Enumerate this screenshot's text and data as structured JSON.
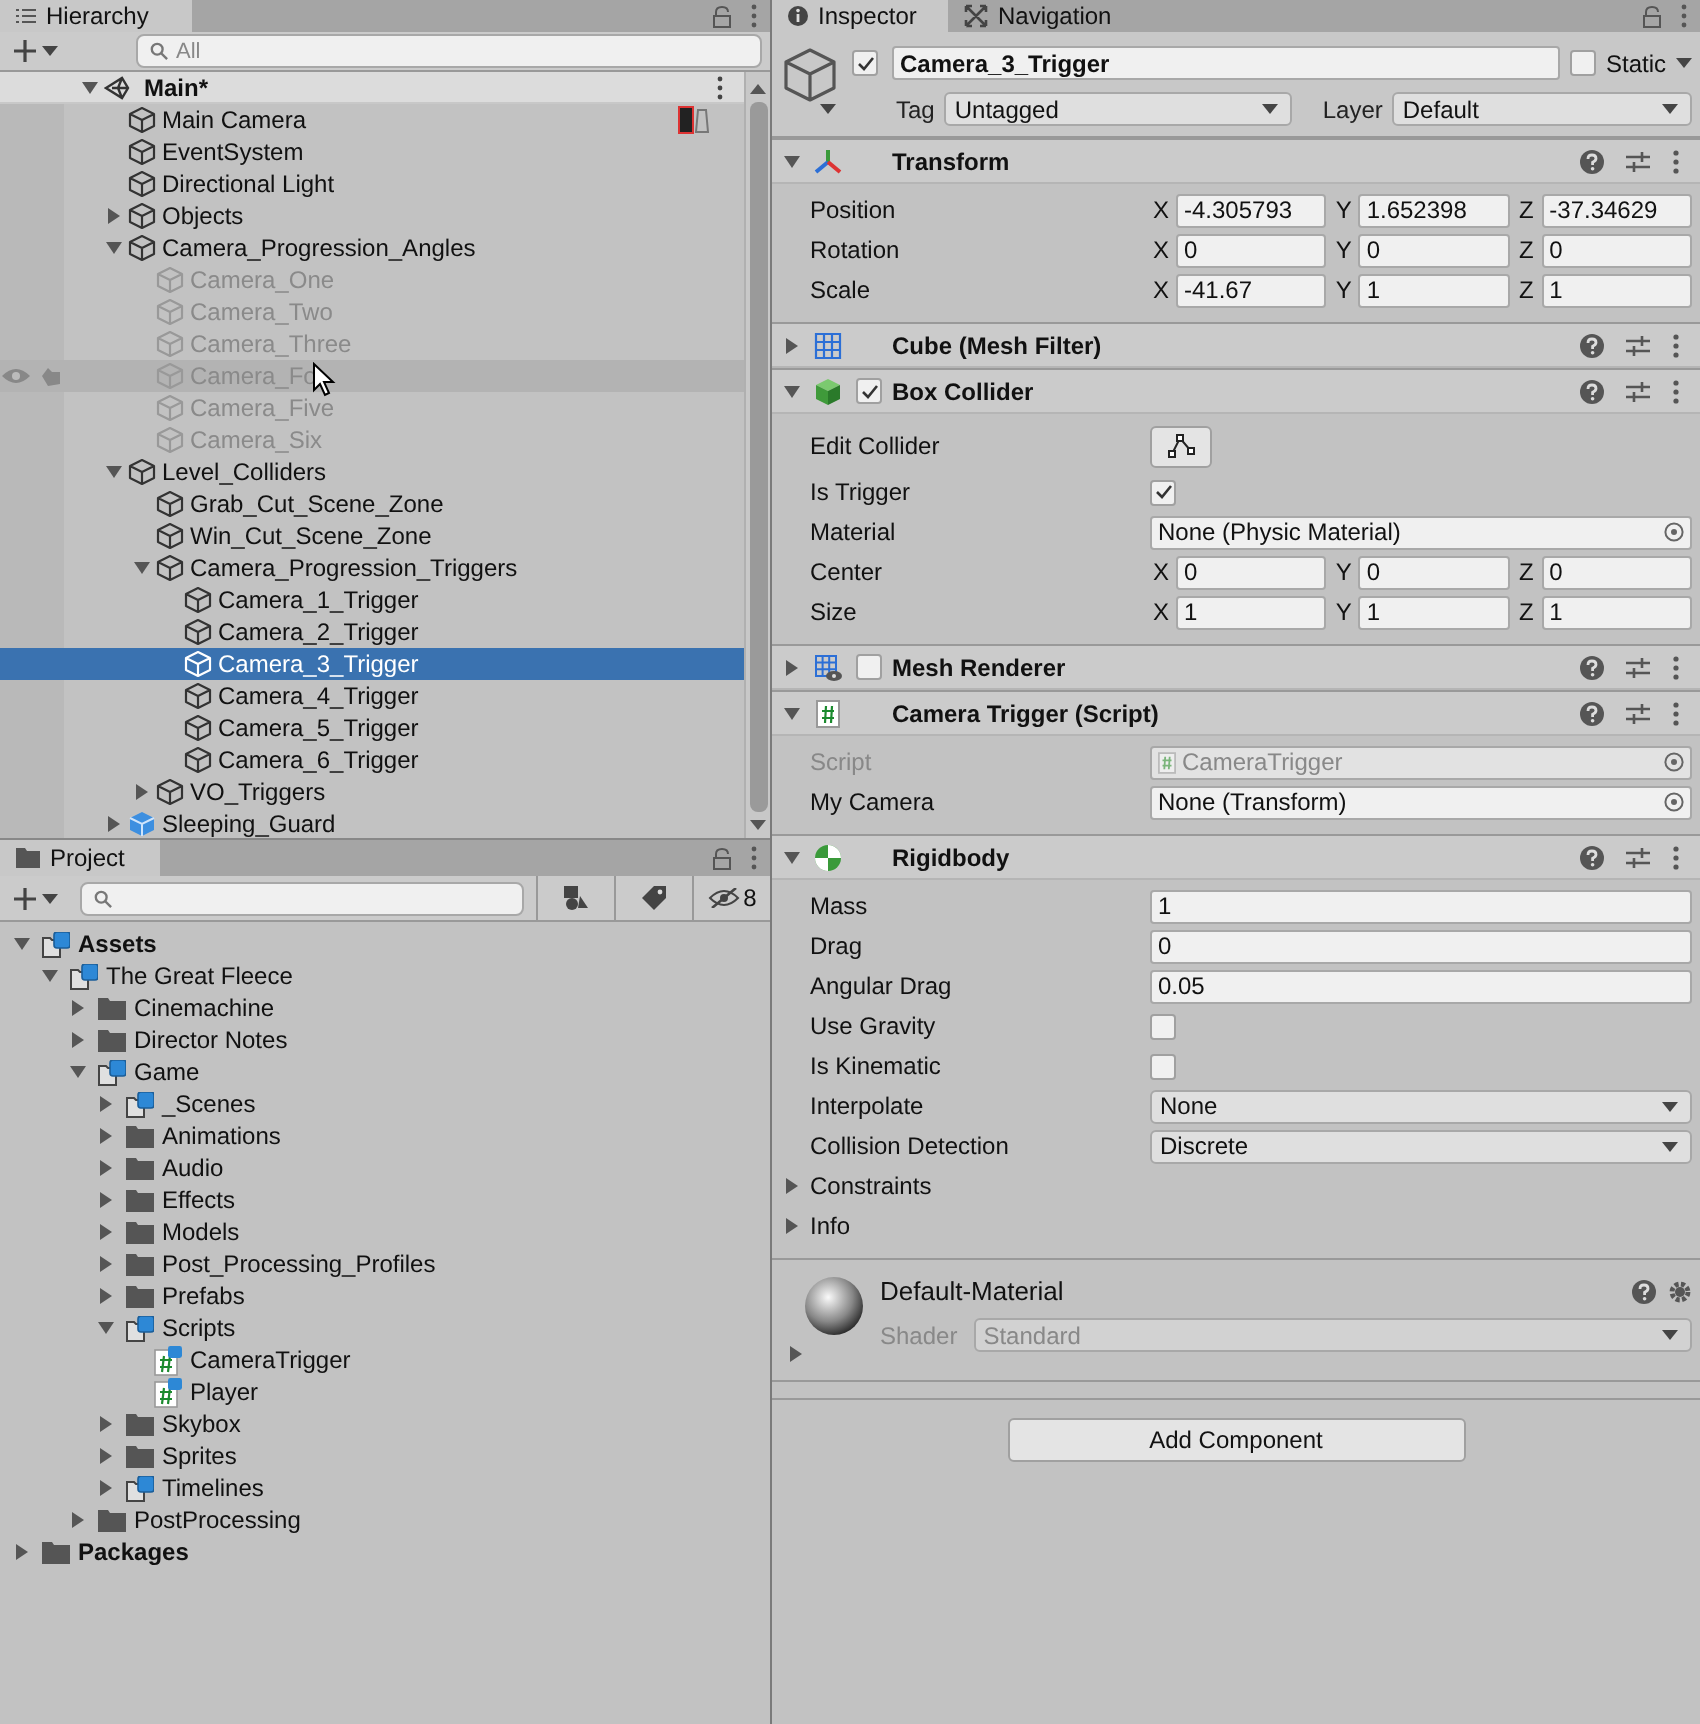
{
  "hierarchy": {
    "tab": "Hierarchy",
    "search_placeholder": "All",
    "scene": {
      "name": "Main*",
      "expanded": true
    },
    "items": [
      {
        "name": "Main Camera",
        "kind": "object",
        "active": true,
        "selected": false,
        "gizmo": true
      },
      {
        "name": "EventSystem",
        "kind": "object",
        "active": true,
        "selected": false
      },
      {
        "name": "Directional Light",
        "kind": "object",
        "active": true,
        "selected": false
      },
      {
        "name": "Objects",
        "kind": "object",
        "active": true,
        "selected": false,
        "expanded": false
      },
      {
        "name": "Camera_Progression_Angles",
        "kind": "object",
        "active": true,
        "selected": false,
        "expanded": true,
        "children": [
          {
            "name": "Camera_One",
            "kind": "object",
            "active": false,
            "selected": false
          },
          {
            "name": "Camera_Two",
            "kind": "object",
            "active": false,
            "selected": false
          },
          {
            "name": "Camera_Three",
            "kind": "object",
            "active": false,
            "selected": false
          },
          {
            "name": "Camera_Fo",
            "kind": "object",
            "active": false,
            "selected": false,
            "hovered": true
          },
          {
            "name": "Camera_Five",
            "kind": "object",
            "active": false,
            "selected": false
          },
          {
            "name": "Camera_Six",
            "kind": "object",
            "active": false,
            "selected": false
          }
        ]
      },
      {
        "name": "Level_Colliders",
        "kind": "object",
        "active": true,
        "selected": false,
        "expanded": true,
        "children": [
          {
            "name": "Grab_Cut_Scene_Zone",
            "kind": "object",
            "active": true,
            "selected": false
          },
          {
            "name": "Win_Cut_Scene_Zone",
            "kind": "object",
            "active": true,
            "selected": false
          },
          {
            "name": "Camera_Progression_Triggers",
            "kind": "object",
            "active": true,
            "selected": false,
            "expanded": true,
            "children": [
              {
                "name": "Camera_1_Trigger",
                "kind": "object",
                "active": true,
                "selected": false
              },
              {
                "name": "Camera_2_Trigger",
                "kind": "object",
                "active": true,
                "selected": false
              },
              {
                "name": "Camera_3_Trigger",
                "kind": "object",
                "active": true,
                "selected": true
              },
              {
                "name": "Camera_4_Trigger",
                "kind": "object",
                "active": true,
                "selected": false
              },
              {
                "name": "Camera_5_Trigger",
                "kind": "object",
                "active": true,
                "selected": false
              },
              {
                "name": "Camera_6_Trigger",
                "kind": "object",
                "active": true,
                "selected": false
              }
            ]
          },
          {
            "name": "VO_Triggers",
            "kind": "object",
            "active": true,
            "selected": false,
            "expanded": false
          }
        ]
      },
      {
        "name": "Sleeping_Guard",
        "kind": "prefab",
        "active": true,
        "selected": false,
        "expanded": false
      }
    ]
  },
  "project": {
    "tab": "Project",
    "hidden_count": "8",
    "items": [
      {
        "name": "Assets",
        "kind": "package",
        "expanded": true,
        "children": [
          {
            "name": "The Great Fleece",
            "kind": "package",
            "expanded": true,
            "children": [
              {
                "name": "Cinemachine",
                "kind": "folder",
                "expanded": false
              },
              {
                "name": "Director Notes",
                "kind": "folder",
                "expanded": false
              },
              {
                "name": "Game",
                "kind": "package",
                "expanded": true,
                "children": [
                  {
                    "name": "_Scenes",
                    "kind": "package",
                    "expanded": false
                  },
                  {
                    "name": "Animations",
                    "kind": "folder",
                    "expanded": false
                  },
                  {
                    "name": "Audio",
                    "kind": "folder",
                    "expanded": false
                  },
                  {
                    "name": "Effects",
                    "kind": "folder",
                    "expanded": false
                  },
                  {
                    "name": "Models",
                    "kind": "folder",
                    "expanded": false
                  },
                  {
                    "name": "Post_Processing_Profiles",
                    "kind": "folder",
                    "expanded": false
                  },
                  {
                    "name": "Prefabs",
                    "kind": "folder",
                    "expanded": false
                  },
                  {
                    "name": "Scripts",
                    "kind": "package",
                    "expanded": true,
                    "children": [
                      {
                        "name": "CameraTrigger",
                        "kind": "script"
                      },
                      {
                        "name": "Player",
                        "kind": "script"
                      }
                    ]
                  },
                  {
                    "name": "Skybox",
                    "kind": "folder",
                    "expanded": false
                  },
                  {
                    "name": "Sprites",
                    "kind": "folder",
                    "expanded": false
                  },
                  {
                    "name": "Timelines",
                    "kind": "package",
                    "expanded": false
                  }
                ]
              },
              {
                "name": "PostProcessing",
                "kind": "folder",
                "expanded": false
              }
            ]
          }
        ]
      },
      {
        "name": "Packages",
        "kind": "folder",
        "expanded": false
      }
    ]
  },
  "inspector": {
    "tabs": [
      {
        "label": "Inspector",
        "selected": true
      },
      {
        "label": "Navigation",
        "selected": false
      }
    ],
    "object": {
      "active": true,
      "name": "Camera_3_Trigger",
      "static_label": "Static",
      "static": false,
      "tag_label": "Tag",
      "tag": "Untagged",
      "layer_label": "Layer",
      "layer": "Default"
    },
    "components": [
      {
        "title": "Transform",
        "kind": "transform",
        "expanded": true,
        "fields": [
          {
            "kind": "vector",
            "label": "Position",
            "values": [
              {
                "axis": "X",
                "value": "-4.305793"
              },
              {
                "axis": "Y",
                "value": "1.652398"
              },
              {
                "axis": "Z",
                "value": "-37.34629"
              }
            ]
          },
          {
            "kind": "vector",
            "label": "Rotation",
            "values": [
              {
                "axis": "X",
                "value": "0"
              },
              {
                "axis": "Y",
                "value": "0"
              },
              {
                "axis": "Z",
                "value": "0"
              }
            ]
          },
          {
            "kind": "vector",
            "label": "Scale",
            "values": [
              {
                "axis": "X",
                "value": "-41.67"
              },
              {
                "axis": "Y",
                "value": "1"
              },
              {
                "axis": "Z",
                "value": "1"
              }
            ]
          }
        ]
      },
      {
        "title": "Cube (Mesh Filter)",
        "kind": "mesh_filter",
        "expanded": false
      },
      {
        "title": "Box Collider",
        "kind": "box_collider",
        "expanded": true,
        "enabled": true,
        "fields": [
          {
            "kind": "button",
            "label": "Edit Collider"
          },
          {
            "kind": "checkbox",
            "label": "Is Trigger",
            "checked": true
          },
          {
            "kind": "object",
            "label": "Material",
            "value": "None (Physic Material)",
            "disabled": false
          },
          {
            "kind": "vector",
            "label": "Center",
            "values": [
              {
                "axis": "X",
                "value": "0"
              },
              {
                "axis": "Y",
                "value": "0"
              },
              {
                "axis": "Z",
                "value": "0"
              }
            ]
          },
          {
            "kind": "vector",
            "label": "Size",
            "values": [
              {
                "axis": "X",
                "value": "1"
              },
              {
                "axis": "Y",
                "value": "1"
              },
              {
                "axis": "Z",
                "value": "1"
              }
            ]
          }
        ]
      },
      {
        "title": "Mesh Renderer",
        "kind": "mesh_renderer",
        "expanded": false,
        "enabled": false
      },
      {
        "title": "Camera Trigger (Script)",
        "kind": "script",
        "expanded": true,
        "fields": [
          {
            "kind": "script_reference",
            "label": "Script",
            "value": "CameraTrigger",
            "disabled": true
          },
          {
            "kind": "object",
            "label": "My Camera",
            "value": "None (Transform)",
            "disabled": false
          }
        ]
      },
      {
        "title": "Rigidbody",
        "kind": "rigidbody",
        "expanded": true,
        "fields": [
          {
            "kind": "text",
            "label": "Mass",
            "value": "1"
          },
          {
            "kind": "text",
            "label": "Drag",
            "value": "0"
          },
          {
            "kind": "text",
            "label": "Angular Drag",
            "value": "0.05"
          },
          {
            "kind": "checkbox",
            "label": "Use Gravity",
            "checked": false
          },
          {
            "kind": "checkbox",
            "label": "Is Kinematic",
            "checked": false
          },
          {
            "kind": "dropdown",
            "label": "Interpolate",
            "value": "None"
          },
          {
            "kind": "dropdown",
            "label": "Collision Detection",
            "value": "Discrete"
          },
          {
            "kind": "foldout",
            "label": "Constraints",
            "expanded": false
          },
          {
            "kind": "foldout",
            "label": "Info",
            "expanded": false
          }
        ]
      }
    ],
    "material": {
      "name": "Default-Material",
      "shader_label": "Shader",
      "shader": "Standard",
      "expanded": false
    },
    "add_component": "Add Component"
  }
}
